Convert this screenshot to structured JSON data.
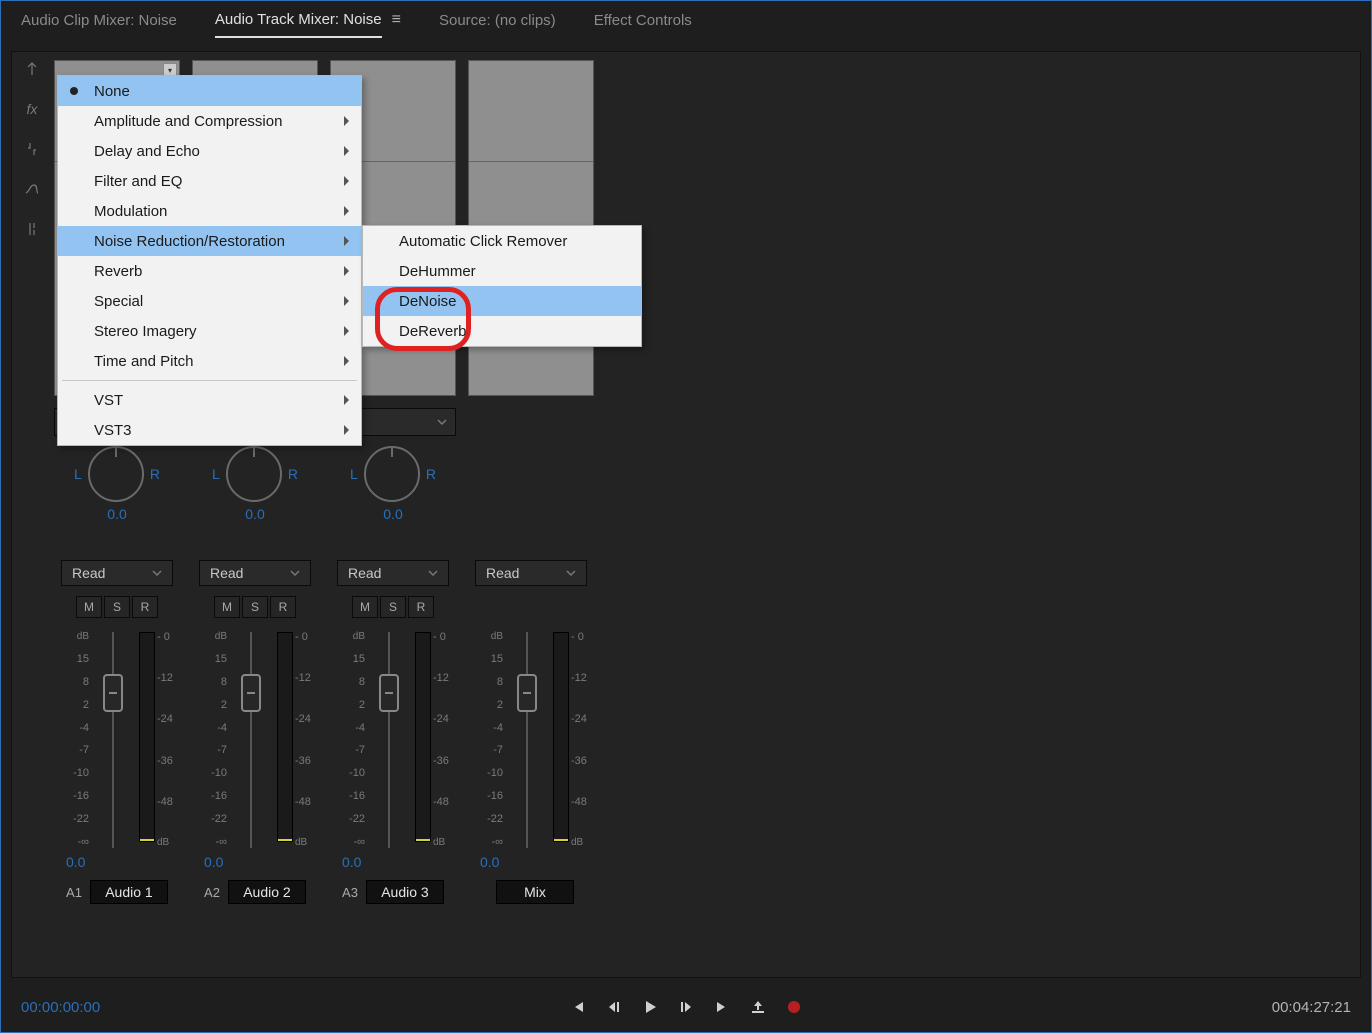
{
  "tabs": {
    "clip_mixer": "Audio Clip Mixer: Noise",
    "track_mixer": "Audio Track Mixer: Noise",
    "source": "Source: (no clips)",
    "effect_controls": "Effect Controls"
  },
  "menu": {
    "none": "None",
    "amp": "Amplitude and Compression",
    "delay": "Delay and Echo",
    "filter": "Filter and EQ",
    "mod": "Modulation",
    "noise": "Noise Reduction/Restoration",
    "reverb": "Reverb",
    "special": "Special",
    "stereo": "Stereo Imagery",
    "time": "Time and Pitch",
    "vst": "VST",
    "vst3": "VST3"
  },
  "submenu": {
    "auto_click": "Automatic Click Remover",
    "dehummer": "DeHummer",
    "denoise": "DeNoise",
    "dereverb": "DeReverb"
  },
  "channel": {
    "pan_left": "L",
    "pan_right": "R",
    "pan_value": "0.0",
    "read": "Read",
    "mute": "M",
    "solo": "S",
    "record": "R",
    "vol": "0.0"
  },
  "fader_scale": [
    "dB",
    "15",
    "8",
    "2",
    "-4",
    "-7",
    "-10",
    "-16",
    "-22",
    "-∞"
  ],
  "meter_scale": [
    "- 0",
    "-12",
    "-24",
    "-36",
    "-48",
    "dB"
  ],
  "tracks": [
    {
      "id": "A1",
      "name": "Audio 1"
    },
    {
      "id": "A2",
      "name": "Audio 2"
    },
    {
      "id": "A3",
      "name": "Audio 3"
    },
    {
      "id": "",
      "name": "Mix"
    }
  ],
  "timecode": {
    "left": "00:00:00:00",
    "right": "00:04:27:21"
  }
}
